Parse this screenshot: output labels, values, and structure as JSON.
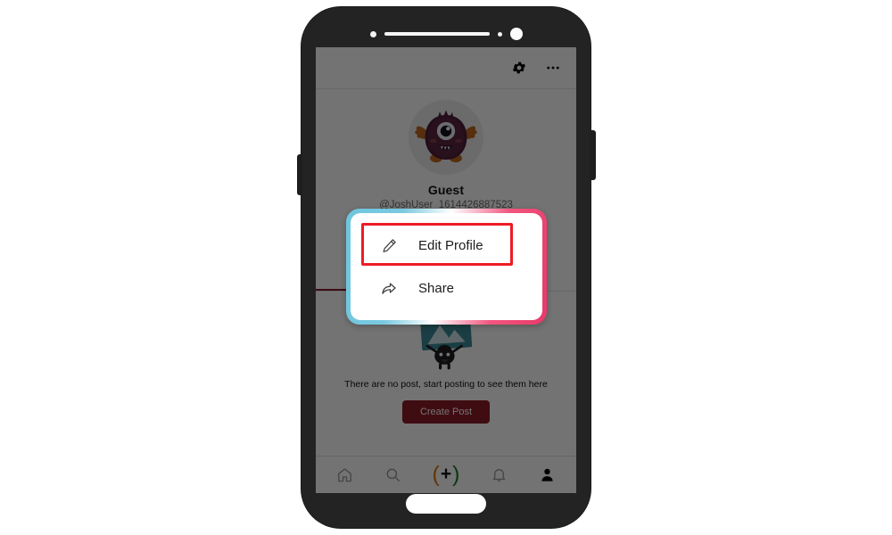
{
  "device": {
    "label": "android-phone-mockup",
    "frame_color": "#252525",
    "home_button_label": "home-pill"
  },
  "header": {
    "settings_icon": "gear-icon",
    "more_icon": "more-options-icon"
  },
  "profile": {
    "avatar_alt": "monster-avatar",
    "name": "Guest",
    "handle": "@JoshUser_1614426887523"
  },
  "tabs": [
    {
      "label": ""
    },
    {
      "label": ""
    }
  ],
  "empty_state": {
    "art_alt": "no-posts-illustration",
    "message": "There are no post, start posting to see them here",
    "button_label": "Create Post"
  },
  "popup": {
    "border_start_color": "#6ec6de",
    "border_end_color": "#e8396a",
    "items": [
      {
        "label": "Edit Profile",
        "icon": "pencil-icon",
        "highlighted": true
      },
      {
        "label": "Share",
        "icon": "share-arrow-icon",
        "highlighted": false
      }
    ]
  },
  "annotation": {
    "color": "#ee1c25",
    "target": "Edit Profile"
  },
  "bottom_nav": {
    "items": [
      {
        "icon": "home-icon",
        "label": "Home",
        "active": false
      },
      {
        "icon": "search-icon",
        "label": "Search",
        "active": false
      },
      {
        "icon": "add-post-icon",
        "label": "Create",
        "active": false
      },
      {
        "icon": "bell-icon",
        "label": "Notifications",
        "active": false
      },
      {
        "icon": "person-icon",
        "label": "Profile",
        "active": true
      }
    ],
    "add_button": {
      "left_paren": "(",
      "plus": "+",
      "right_paren": ")",
      "left_paren_color": "#d97706",
      "right_paren_color": "#1d7a27"
    }
  }
}
